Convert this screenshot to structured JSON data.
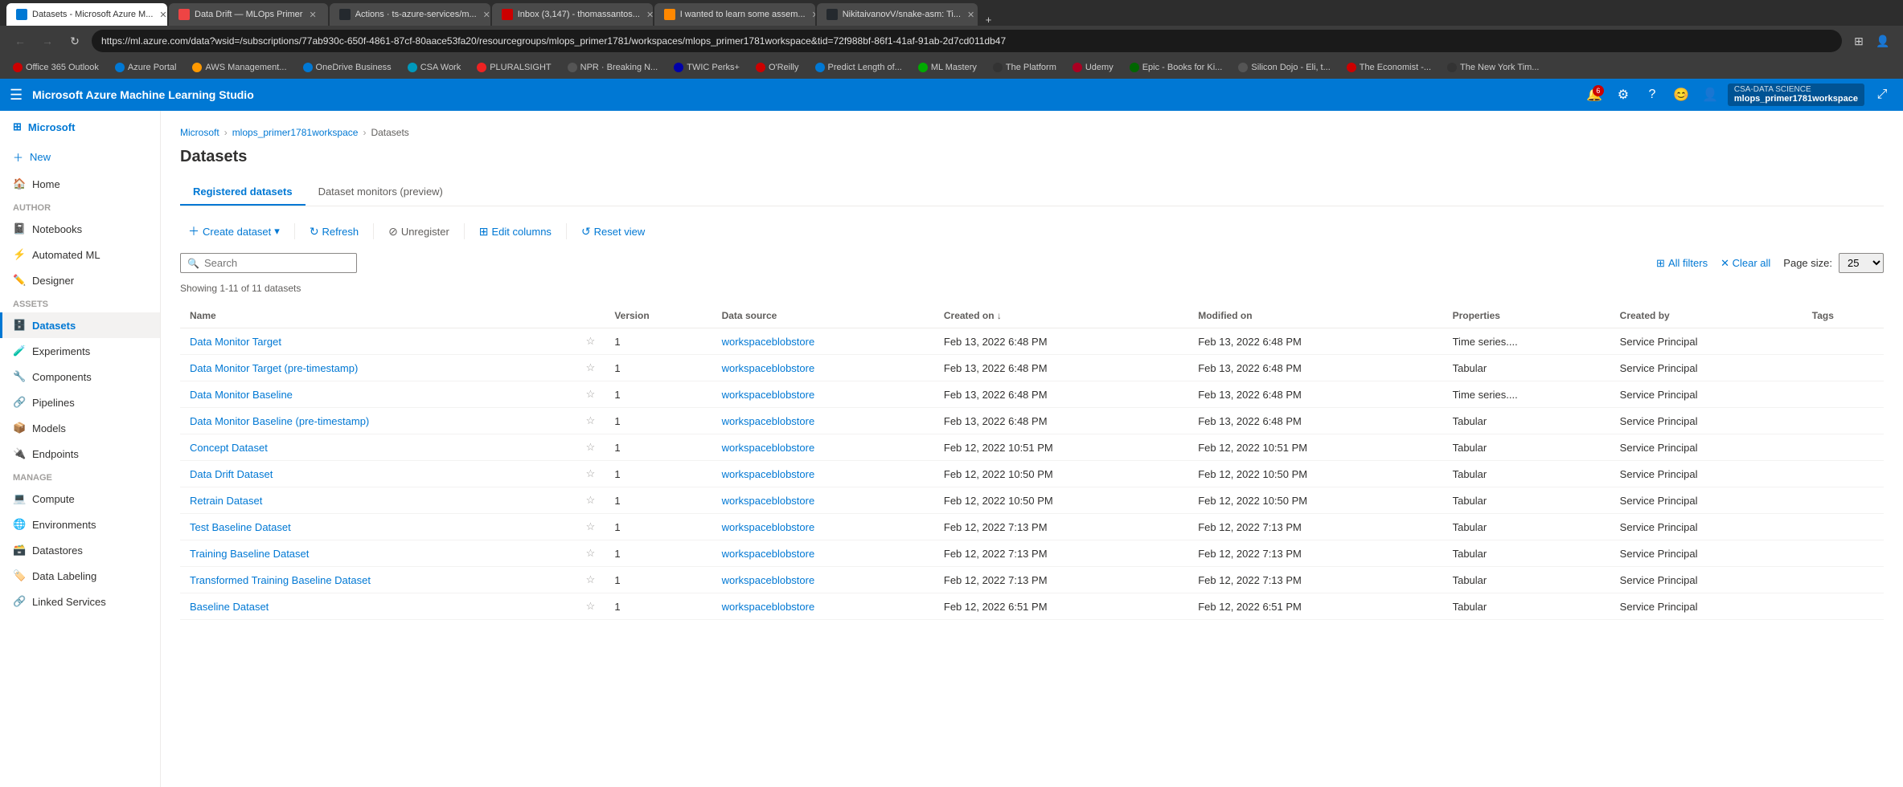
{
  "browser": {
    "tabs": [
      {
        "label": "Datasets - Microsoft Azure M...",
        "active": true,
        "favicon_color": "#0078d4"
      },
      {
        "label": "Data Drift — MLOps Primer",
        "active": false,
        "favicon_color": "#e44"
      },
      {
        "label": "Actions · ts-azure-services/m...",
        "active": false,
        "favicon_color": "#24292e"
      },
      {
        "label": "Inbox (3,147) - thomassantos...",
        "active": false,
        "favicon_color": "#c00"
      },
      {
        "label": "I wanted to learn some assem...",
        "active": false,
        "favicon_color": "#f80"
      },
      {
        "label": "NikitaivanovV/snake-asm: Ti...",
        "active": false,
        "favicon_color": "#24292e"
      }
    ],
    "address": "https://ml.azure.com/data?wsid=/subscriptions/77ab930c-650f-4861-87cf-80aace53fa20/resourcegroups/mlops_primer1781/workspaces/mlops_primer1781workspace&tid=72f988bf-86f1-41af-91ab-2d7cd011db47"
  },
  "bookmarks": [
    {
      "label": "Office 365 Outlook",
      "color": "#c00"
    },
    {
      "label": "Azure Portal",
      "color": "#0078d4"
    },
    {
      "label": "AWS Management...",
      "color": "#f90"
    },
    {
      "label": "OneDrive Business",
      "color": "#0078d4"
    },
    {
      "label": "CSA Work",
      "color": "#0099bc"
    },
    {
      "label": "PLURALSIGHT",
      "color": "#e22"
    },
    {
      "label": "NPR · Breaking N...",
      "color": "#555"
    },
    {
      "label": "TWIC Perks+",
      "color": "#00a"
    },
    {
      "label": "O'Reilly",
      "color": "#c00"
    },
    {
      "label": "Predict Length of...",
      "color": "#0078d4"
    },
    {
      "label": "ML Mastery",
      "color": "#0a0"
    },
    {
      "label": "The Platform",
      "color": "#333"
    },
    {
      "label": "Udemy",
      "color": "#a02"
    },
    {
      "label": "Epic - Books for Ki...",
      "color": "#060"
    },
    {
      "label": "Silicon Dojo - Eli, t...",
      "color": "#333"
    },
    {
      "label": "The Economist -...",
      "color": "#c00"
    },
    {
      "label": "The New York Tim...",
      "color": "#333"
    }
  ],
  "app_header": {
    "title": "Microsoft Azure Machine Learning Studio",
    "workspace_label": "CSA-DATA SCIENCE",
    "workspace_name": "mlops_primer1781workspace"
  },
  "sidebar": {
    "logo_text": "Microsoft",
    "new_label": "New",
    "home_label": "Home",
    "sections": [
      {
        "label": "Author",
        "items": [
          {
            "label": "Notebooks",
            "icon": "📓"
          },
          {
            "label": "Automated ML",
            "icon": "⚡"
          },
          {
            "label": "Designer",
            "icon": "✏️"
          }
        ]
      },
      {
        "label": "Assets",
        "items": [
          {
            "label": "Datasets",
            "icon": "🗄️",
            "active": true
          },
          {
            "label": "Experiments",
            "icon": "🧪"
          },
          {
            "label": "Components",
            "icon": "🔧"
          },
          {
            "label": "Pipelines",
            "icon": "🔗"
          },
          {
            "label": "Models",
            "icon": "📦"
          },
          {
            "label": "Endpoints",
            "icon": "🔌"
          }
        ]
      },
      {
        "label": "Manage",
        "items": [
          {
            "label": "Compute",
            "icon": "💻"
          },
          {
            "label": "Environments",
            "icon": "🌐"
          },
          {
            "label": "Datastores",
            "icon": "🗃️"
          },
          {
            "label": "Data Labeling",
            "icon": "🏷️"
          },
          {
            "label": "Linked Services",
            "icon": "🔗"
          }
        ]
      }
    ]
  },
  "breadcrumb": {
    "items": [
      "Microsoft",
      "mlops_primer1781workspace",
      "Datasets"
    ]
  },
  "page_title": "Datasets",
  "tabs": [
    {
      "label": "Registered datasets",
      "active": true
    },
    {
      "label": "Dataset monitors (preview)",
      "active": false
    }
  ],
  "toolbar": {
    "create_label": "Create dataset",
    "refresh_label": "Refresh",
    "unregister_label": "Unregister",
    "edit_columns_label": "Edit columns",
    "reset_view_label": "Reset view"
  },
  "search": {
    "placeholder": "Search"
  },
  "dataset_count": "Showing 1-11 of 11 datasets",
  "table": {
    "columns": [
      "Name",
      "",
      "Version",
      "Data source",
      "Created on ↓",
      "Modified on",
      "Properties",
      "Created by",
      "Tags"
    ],
    "rows": [
      {
        "name": "Data Monitor Target",
        "version": "1",
        "datasource": "workspaceblobstore",
        "created": "Feb 13, 2022 6:48 PM",
        "modified": "Feb 13, 2022 6:48 PM",
        "properties": "Time series....",
        "created_by": "Service Principal",
        "tags": ""
      },
      {
        "name": "Data Monitor Target (pre-timestamp)",
        "version": "1",
        "datasource": "workspaceblobstore",
        "created": "Feb 13, 2022 6:48 PM",
        "modified": "Feb 13, 2022 6:48 PM",
        "properties": "Tabular",
        "created_by": "Service Principal",
        "tags": ""
      },
      {
        "name": "Data Monitor Baseline",
        "version": "1",
        "datasource": "workspaceblobstore",
        "created": "Feb 13, 2022 6:48 PM",
        "modified": "Feb 13, 2022 6:48 PM",
        "properties": "Time series....",
        "created_by": "Service Principal",
        "tags": ""
      },
      {
        "name": "Data Monitor Baseline (pre-timestamp)",
        "version": "1",
        "datasource": "workspaceblobstore",
        "created": "Feb 13, 2022 6:48 PM",
        "modified": "Feb 13, 2022 6:48 PM",
        "properties": "Tabular",
        "created_by": "Service Principal",
        "tags": ""
      },
      {
        "name": "Concept Dataset",
        "version": "1",
        "datasource": "workspaceblobstore",
        "created": "Feb 12, 2022 10:51 PM",
        "modified": "Feb 12, 2022 10:51 PM",
        "properties": "Tabular",
        "created_by": "Service Principal",
        "tags": ""
      },
      {
        "name": "Data Drift Dataset",
        "version": "1",
        "datasource": "workspaceblobstore",
        "created": "Feb 12, 2022 10:50 PM",
        "modified": "Feb 12, 2022 10:50 PM",
        "properties": "Tabular",
        "created_by": "Service Principal",
        "tags": ""
      },
      {
        "name": "Retrain Dataset",
        "version": "1",
        "datasource": "workspaceblobstore",
        "created": "Feb 12, 2022 10:50 PM",
        "modified": "Feb 12, 2022 10:50 PM",
        "properties": "Tabular",
        "created_by": "Service Principal",
        "tags": ""
      },
      {
        "name": "Test Baseline Dataset",
        "version": "1",
        "datasource": "workspaceblobstore",
        "created": "Feb 12, 2022 7:13 PM",
        "modified": "Feb 12, 2022 7:13 PM",
        "properties": "Tabular",
        "created_by": "Service Principal",
        "tags": ""
      },
      {
        "name": "Training Baseline Dataset",
        "version": "1",
        "datasource": "workspaceblobstore",
        "created": "Feb 12, 2022 7:13 PM",
        "modified": "Feb 12, 2022 7:13 PM",
        "properties": "Tabular",
        "created_by": "Service Principal",
        "tags": ""
      },
      {
        "name": "Transformed Training Baseline Dataset",
        "version": "1",
        "datasource": "workspaceblobstore",
        "created": "Feb 12, 2022 7:13 PM",
        "modified": "Feb 12, 2022 7:13 PM",
        "properties": "Tabular",
        "created_by": "Service Principal",
        "tags": ""
      },
      {
        "name": "Baseline Dataset",
        "version": "1",
        "datasource": "workspaceblobstore",
        "created": "Feb 12, 2022 6:51 PM",
        "modified": "Feb 12, 2022 6:51 PM",
        "properties": "Tabular",
        "created_by": "Service Principal",
        "tags": ""
      }
    ]
  },
  "right_actions": {
    "all_filters_label": "All filters",
    "clear_all_label": "Clear all",
    "page_size_label": "Page size:",
    "page_size_value": "25"
  }
}
